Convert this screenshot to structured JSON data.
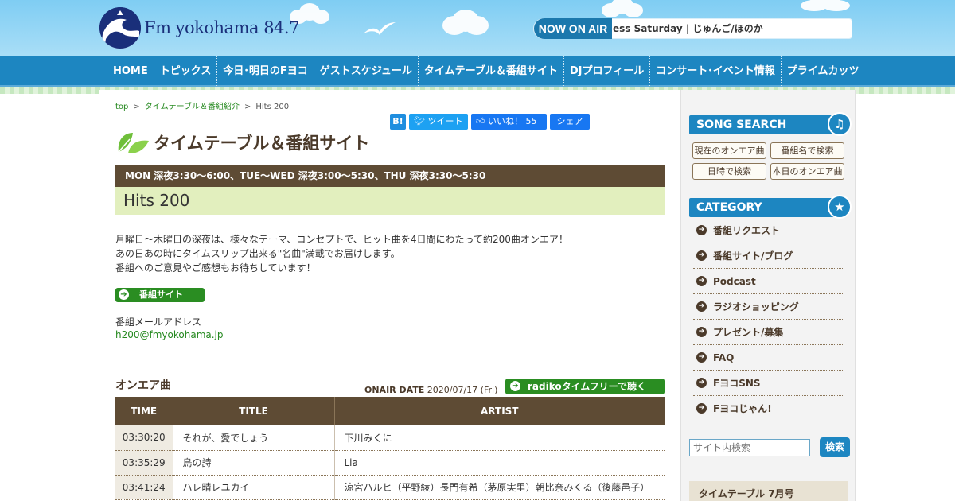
{
  "header": {
    "logo_text": "Fm yokohama 84.7",
    "now_on_air_label": "NOW ON AIR",
    "now_on_air_text": "ess Saturday  |  じゅんご/ほのか"
  },
  "nav": {
    "items": [
      {
        "label": "HOME"
      },
      {
        "label": "トピックス"
      },
      {
        "label": "今日･明日のFヨコ"
      },
      {
        "label": "ゲストスケジュール"
      },
      {
        "label": "タイムテーブル＆番組サイト"
      },
      {
        "label": "DJプロフィール"
      },
      {
        "label": "コンサート･イベント情報"
      },
      {
        "label": "プライムカッツ"
      }
    ]
  },
  "breadcrumb": {
    "top": "top",
    "section": "タイムテーブル＆番組紹介",
    "current": "Hits 200",
    "sep": ">"
  },
  "share": {
    "hatena": "B!",
    "tweet": "ツイート",
    "like": "いいね！ 55",
    "fb_share": "シェア"
  },
  "page": {
    "title": "タイムテーブル＆番組サイト",
    "schedule": "MON 深夜3:30～6:00、TUE～WED 深夜3:00～5:30、THU 深夜3:30～5:30",
    "program_name": "Hits 200",
    "description": [
      "月曜日～木曜日の深夜は、様々なテーマ、コンセプトで、ヒット曲を4日間にわたって約200曲オンエア！",
      "あの日あの時にタイムスリップ出来る\"名曲\"満載でお届けします。",
      "番組へのご意見やご感想もお待ちしています！"
    ],
    "site_button": "番組サイト",
    "mail_label": "番組メールアドレス",
    "mail_address": "h200@fmyokohama.jp"
  },
  "onair": {
    "heading": "オンエア曲",
    "date_label": "ONAIR DATE",
    "date_value": "2020/07/17 (Fri)",
    "radiko_button": "radikoタイムフリーで聴く",
    "columns": [
      "TIME",
      "TITLE",
      "ARTIST"
    ],
    "rows": [
      {
        "time": "03:30:20",
        "title": "それが、愛でしょう",
        "artist": "下川みくに"
      },
      {
        "time": "03:35:29",
        "title": "鳥の詩",
        "artist": "Lia"
      },
      {
        "time": "03:41:24",
        "title": "ハレ晴レユカイ",
        "artist": "涼宮ハルヒ（平野綾）長門有希（茅原実里）朝比奈みくる（後藤邑子）"
      }
    ]
  },
  "sidebar": {
    "song_search_heading": "SONG SEARCH",
    "song_search_buttons": [
      "現在のオンエア曲",
      "番組名で検索",
      "日時で検索",
      "本日のオンエア曲"
    ],
    "category_heading": "CATEGORY",
    "categories": [
      "番組リクエスト",
      "番組サイト/ブログ",
      "Podcast",
      "ラジオショッピング",
      "プレゼント/募集",
      "FAQ",
      "FヨコSNS",
      "Fヨコじゃん!"
    ],
    "search_placeholder": "サイト内検索",
    "search_button": "検索",
    "timetable_box": "タイムテーブル 7月号"
  },
  "colors": {
    "header_sky": "#7fcdf3",
    "nav_blue": "#1d86c1",
    "brown": "#5e4b34",
    "green": "#2a8d22",
    "program_bg": "#e2efbe"
  }
}
